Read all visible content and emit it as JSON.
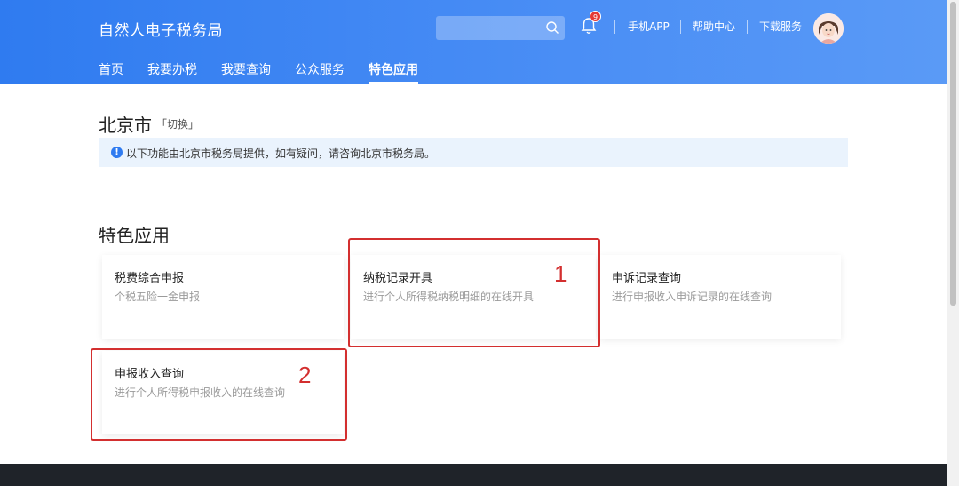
{
  "header": {
    "brand": "自然人电子税务局",
    "search": {
      "placeholder": "",
      "icon": "search-icon"
    },
    "notifications": {
      "count": "9",
      "icon": "bell-icon"
    },
    "links": [
      "手机APP",
      "帮助中心",
      "下载服务"
    ],
    "avatar": "avatar"
  },
  "nav": {
    "items": [
      "首页",
      "我要办税",
      "我要查询",
      "公众服务",
      "特色应用"
    ],
    "active": "特色应用"
  },
  "location": {
    "city": "北京市",
    "switch_label": "「切换」"
  },
  "notice": {
    "icon": "info-icon",
    "text": "以下功能由北京市税务局提供，如有疑问，请咨询北京市税务局。"
  },
  "section": {
    "title": "特色应用",
    "cards": [
      {
        "title": "税费综合申报",
        "desc": "个税五险一金申报"
      },
      {
        "title": "纳税记录开具",
        "desc": "进行个人所得税纳税明细的在线开具"
      },
      {
        "title": "申诉记录查询",
        "desc": "进行申报收入申诉记录的在线查询"
      },
      {
        "title": "申报收入查询",
        "desc": "进行个人所得税申报收入的在线查询"
      }
    ]
  },
  "annotations": [
    "1",
    "2"
  ],
  "colors": {
    "header_blue": "#2f7bf0",
    "annotation_red": "#d32f2f"
  }
}
